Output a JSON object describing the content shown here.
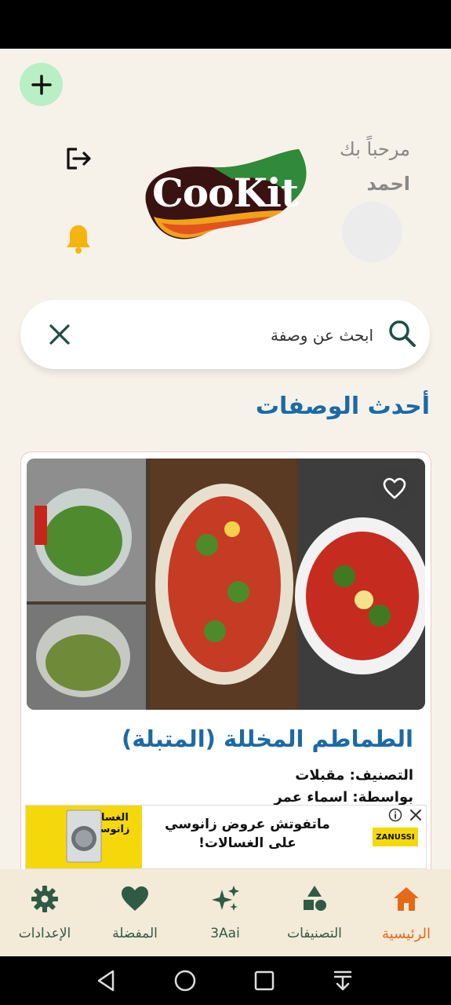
{
  "header": {
    "greeting": "مرحباً بك",
    "user_name": "احمد",
    "logo_text": "CooKit",
    "add_icon": "plus-icon",
    "logout_icon": "logout-icon",
    "notification_icon": "bell-icon"
  },
  "search": {
    "placeholder": "ابحث عن وصفة",
    "search_icon": "search-icon",
    "clear_icon": "close-icon"
  },
  "section": {
    "title": "أحدث الوصفات"
  },
  "recipe_card": {
    "title": "الطماطم المخللة (المتبلة)",
    "category": "التصنيف: مقبلات",
    "author": "بواسطة: اسماء عمر",
    "favorite_icon": "heart-outline-icon"
  },
  "ad": {
    "text": "ماتفوتش عروض زانوسي على الغسالات!",
    "brand": "ZANUSSI",
    "image_label": "الغسالة زانوسي"
  },
  "bottom_nav": {
    "items": [
      {
        "label": "الرئيسية",
        "icon": "home-icon",
        "active": true
      },
      {
        "label": "التصنيفات",
        "icon": "categories-icon",
        "active": false
      },
      {
        "label": "3Aai",
        "icon": "sparkles-icon",
        "active": false
      },
      {
        "label": "المفضلة",
        "icon": "heart-icon",
        "active": false
      },
      {
        "label": "الإعدادات",
        "icon": "gear-icon",
        "active": false
      }
    ]
  },
  "colors": {
    "background": "#f6f2e9",
    "accent_blue": "#1b6aa6",
    "accent_orange": "#e46a18",
    "nav_green": "#2f5a46",
    "fab_green": "#b9efc4"
  }
}
